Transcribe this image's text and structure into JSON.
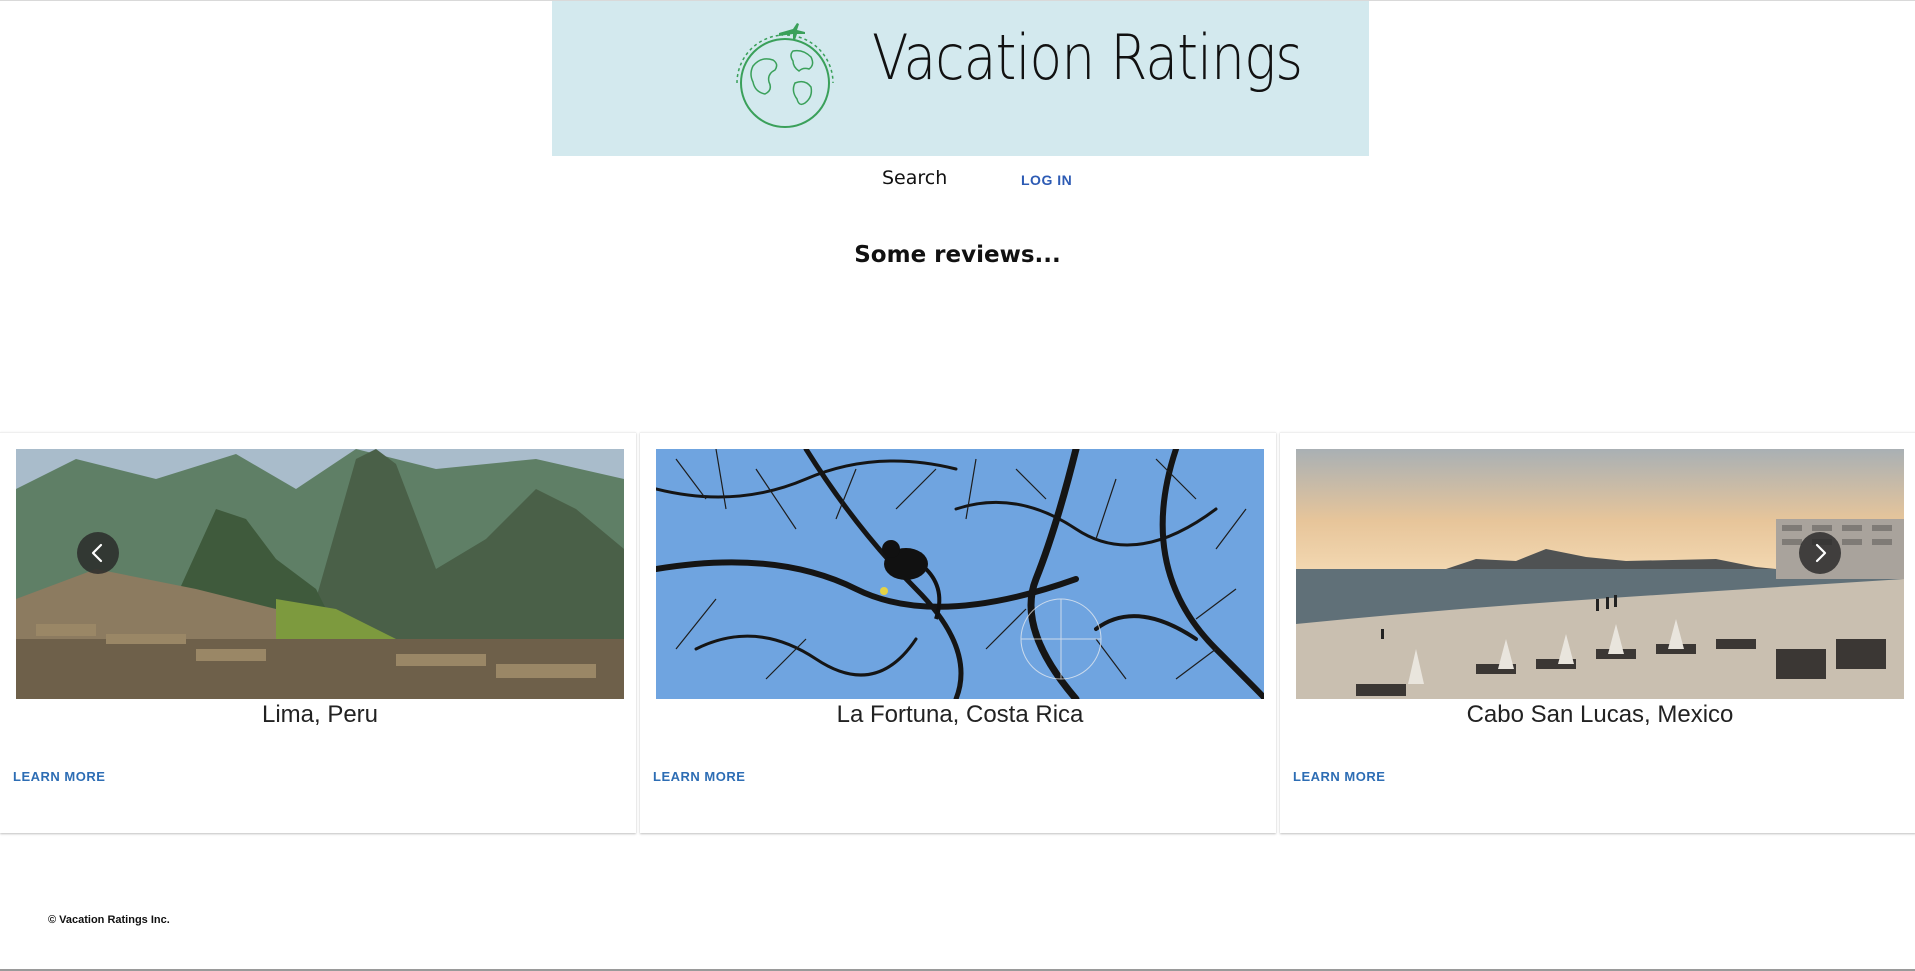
{
  "header": {
    "logo_text": "Vacation Ratings",
    "logo_icon": "globe-with-airplane-icon",
    "logo_color": "#3aa05a",
    "banner_color": "#d3e9ee"
  },
  "nav": {
    "search_label": "Search",
    "login_label": "LOG IN",
    "login_color": "#2d5bb4"
  },
  "section": {
    "title": "Some reviews..."
  },
  "carousel": {
    "prev_icon": "chevron-left-icon",
    "next_icon": "chevron-right-icon",
    "cards": [
      {
        "title": "Lima, Peru",
        "cta": "LEARN MORE"
      },
      {
        "title": "La Fortuna, Costa Rica",
        "cta": "LEARN MORE"
      },
      {
        "title": "Cabo San Lucas, Mexico",
        "cta": "LEARN MORE"
      }
    ]
  },
  "footer": {
    "copyright": "© Vacation Ratings Inc."
  }
}
